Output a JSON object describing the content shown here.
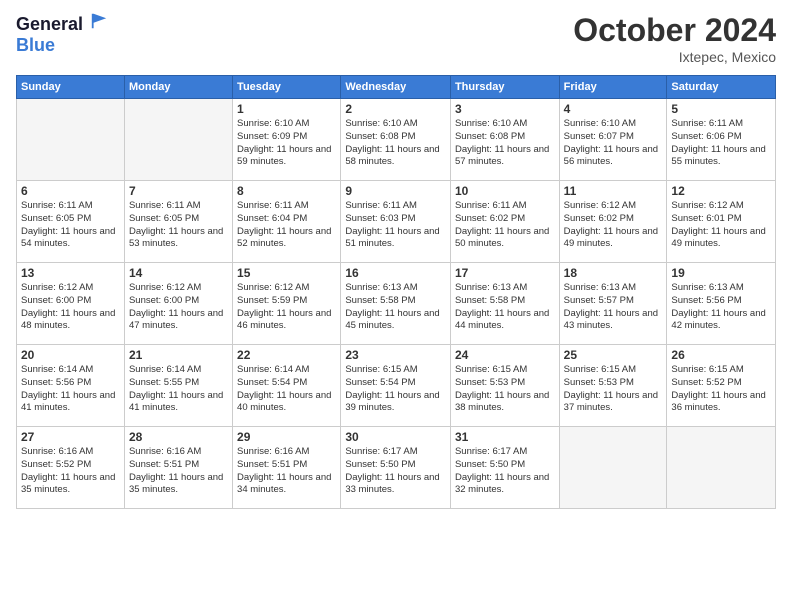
{
  "header": {
    "logo_line1": "General",
    "logo_line2": "Blue",
    "month": "October 2024",
    "location": "Ixtepec, Mexico"
  },
  "weekdays": [
    "Sunday",
    "Monday",
    "Tuesday",
    "Wednesday",
    "Thursday",
    "Friday",
    "Saturday"
  ],
  "weeks": [
    [
      {
        "day": "",
        "info": ""
      },
      {
        "day": "",
        "info": ""
      },
      {
        "day": "1",
        "info": "Sunrise: 6:10 AM\nSunset: 6:09 PM\nDaylight: 11 hours and 59 minutes."
      },
      {
        "day": "2",
        "info": "Sunrise: 6:10 AM\nSunset: 6:08 PM\nDaylight: 11 hours and 58 minutes."
      },
      {
        "day": "3",
        "info": "Sunrise: 6:10 AM\nSunset: 6:08 PM\nDaylight: 11 hours and 57 minutes."
      },
      {
        "day": "4",
        "info": "Sunrise: 6:10 AM\nSunset: 6:07 PM\nDaylight: 11 hours and 56 minutes."
      },
      {
        "day": "5",
        "info": "Sunrise: 6:11 AM\nSunset: 6:06 PM\nDaylight: 11 hours and 55 minutes."
      }
    ],
    [
      {
        "day": "6",
        "info": "Sunrise: 6:11 AM\nSunset: 6:05 PM\nDaylight: 11 hours and 54 minutes."
      },
      {
        "day": "7",
        "info": "Sunrise: 6:11 AM\nSunset: 6:05 PM\nDaylight: 11 hours and 53 minutes."
      },
      {
        "day": "8",
        "info": "Sunrise: 6:11 AM\nSunset: 6:04 PM\nDaylight: 11 hours and 52 minutes."
      },
      {
        "day": "9",
        "info": "Sunrise: 6:11 AM\nSunset: 6:03 PM\nDaylight: 11 hours and 51 minutes."
      },
      {
        "day": "10",
        "info": "Sunrise: 6:11 AM\nSunset: 6:02 PM\nDaylight: 11 hours and 50 minutes."
      },
      {
        "day": "11",
        "info": "Sunrise: 6:12 AM\nSunset: 6:02 PM\nDaylight: 11 hours and 49 minutes."
      },
      {
        "day": "12",
        "info": "Sunrise: 6:12 AM\nSunset: 6:01 PM\nDaylight: 11 hours and 49 minutes."
      }
    ],
    [
      {
        "day": "13",
        "info": "Sunrise: 6:12 AM\nSunset: 6:00 PM\nDaylight: 11 hours and 48 minutes."
      },
      {
        "day": "14",
        "info": "Sunrise: 6:12 AM\nSunset: 6:00 PM\nDaylight: 11 hours and 47 minutes."
      },
      {
        "day": "15",
        "info": "Sunrise: 6:12 AM\nSunset: 5:59 PM\nDaylight: 11 hours and 46 minutes."
      },
      {
        "day": "16",
        "info": "Sunrise: 6:13 AM\nSunset: 5:58 PM\nDaylight: 11 hours and 45 minutes."
      },
      {
        "day": "17",
        "info": "Sunrise: 6:13 AM\nSunset: 5:58 PM\nDaylight: 11 hours and 44 minutes."
      },
      {
        "day": "18",
        "info": "Sunrise: 6:13 AM\nSunset: 5:57 PM\nDaylight: 11 hours and 43 minutes."
      },
      {
        "day": "19",
        "info": "Sunrise: 6:13 AM\nSunset: 5:56 PM\nDaylight: 11 hours and 42 minutes."
      }
    ],
    [
      {
        "day": "20",
        "info": "Sunrise: 6:14 AM\nSunset: 5:56 PM\nDaylight: 11 hours and 41 minutes."
      },
      {
        "day": "21",
        "info": "Sunrise: 6:14 AM\nSunset: 5:55 PM\nDaylight: 11 hours and 41 minutes."
      },
      {
        "day": "22",
        "info": "Sunrise: 6:14 AM\nSunset: 5:54 PM\nDaylight: 11 hours and 40 minutes."
      },
      {
        "day": "23",
        "info": "Sunrise: 6:15 AM\nSunset: 5:54 PM\nDaylight: 11 hours and 39 minutes."
      },
      {
        "day": "24",
        "info": "Sunrise: 6:15 AM\nSunset: 5:53 PM\nDaylight: 11 hours and 38 minutes."
      },
      {
        "day": "25",
        "info": "Sunrise: 6:15 AM\nSunset: 5:53 PM\nDaylight: 11 hours and 37 minutes."
      },
      {
        "day": "26",
        "info": "Sunrise: 6:15 AM\nSunset: 5:52 PM\nDaylight: 11 hours and 36 minutes."
      }
    ],
    [
      {
        "day": "27",
        "info": "Sunrise: 6:16 AM\nSunset: 5:52 PM\nDaylight: 11 hours and 35 minutes."
      },
      {
        "day": "28",
        "info": "Sunrise: 6:16 AM\nSunset: 5:51 PM\nDaylight: 11 hours and 35 minutes."
      },
      {
        "day": "29",
        "info": "Sunrise: 6:16 AM\nSunset: 5:51 PM\nDaylight: 11 hours and 34 minutes."
      },
      {
        "day": "30",
        "info": "Sunrise: 6:17 AM\nSunset: 5:50 PM\nDaylight: 11 hours and 33 minutes."
      },
      {
        "day": "31",
        "info": "Sunrise: 6:17 AM\nSunset: 5:50 PM\nDaylight: 11 hours and 32 minutes."
      },
      {
        "day": "",
        "info": ""
      },
      {
        "day": "",
        "info": ""
      }
    ]
  ]
}
